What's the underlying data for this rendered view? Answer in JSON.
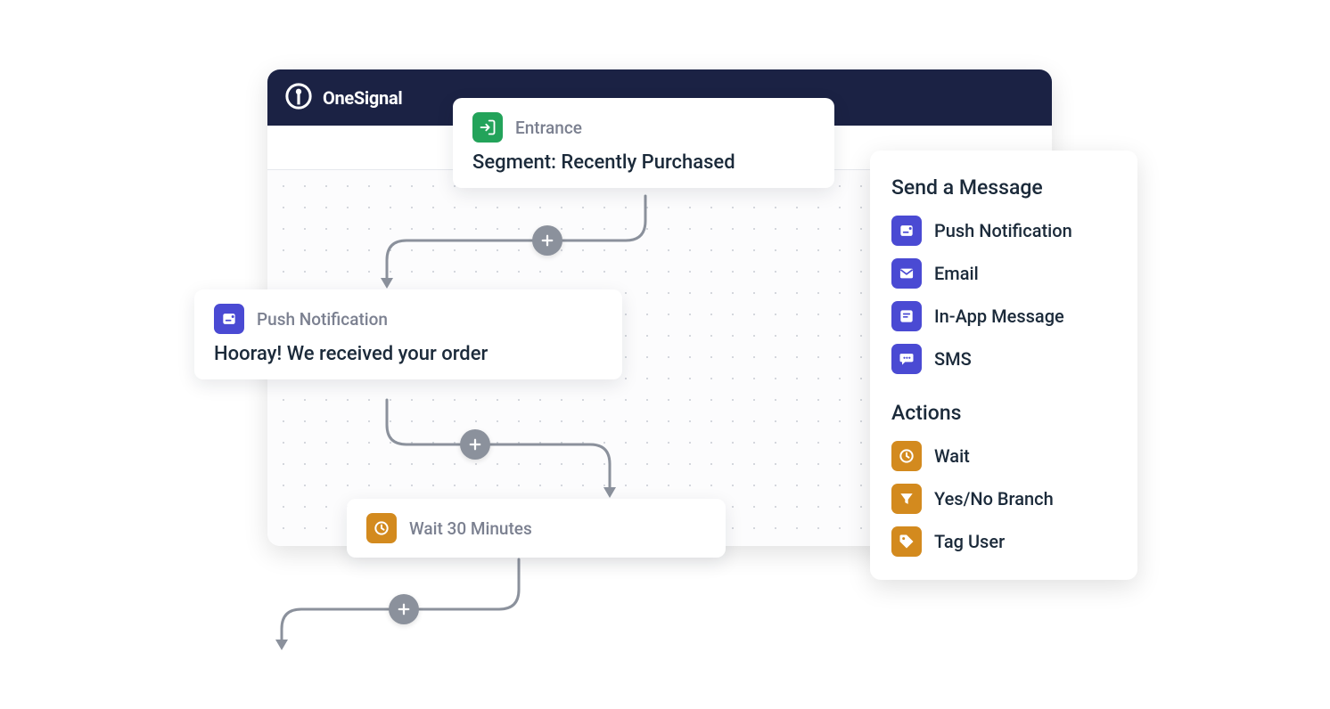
{
  "brand": {
    "name": "OneSignal"
  },
  "nodes": {
    "entrance": {
      "type_label": "Entrance",
      "title": "Segment: Recently Purchased"
    },
    "push": {
      "type_label": "Push Notification",
      "title": "Hooray! We received your order"
    },
    "wait": {
      "type_label": "Wait 30 Minutes"
    }
  },
  "panel": {
    "send_heading": "Send a Message",
    "send_items": [
      {
        "key": "push",
        "label": "Push Notification"
      },
      {
        "key": "email",
        "label": "Email"
      },
      {
        "key": "iam",
        "label": "In-App Message"
      },
      {
        "key": "sms",
        "label": "SMS"
      }
    ],
    "actions_heading": "Actions",
    "action_items": [
      {
        "key": "wait",
        "label": "Wait"
      },
      {
        "key": "branch",
        "label": "Yes/No Branch"
      },
      {
        "key": "tag",
        "label": "Tag User"
      }
    ]
  }
}
